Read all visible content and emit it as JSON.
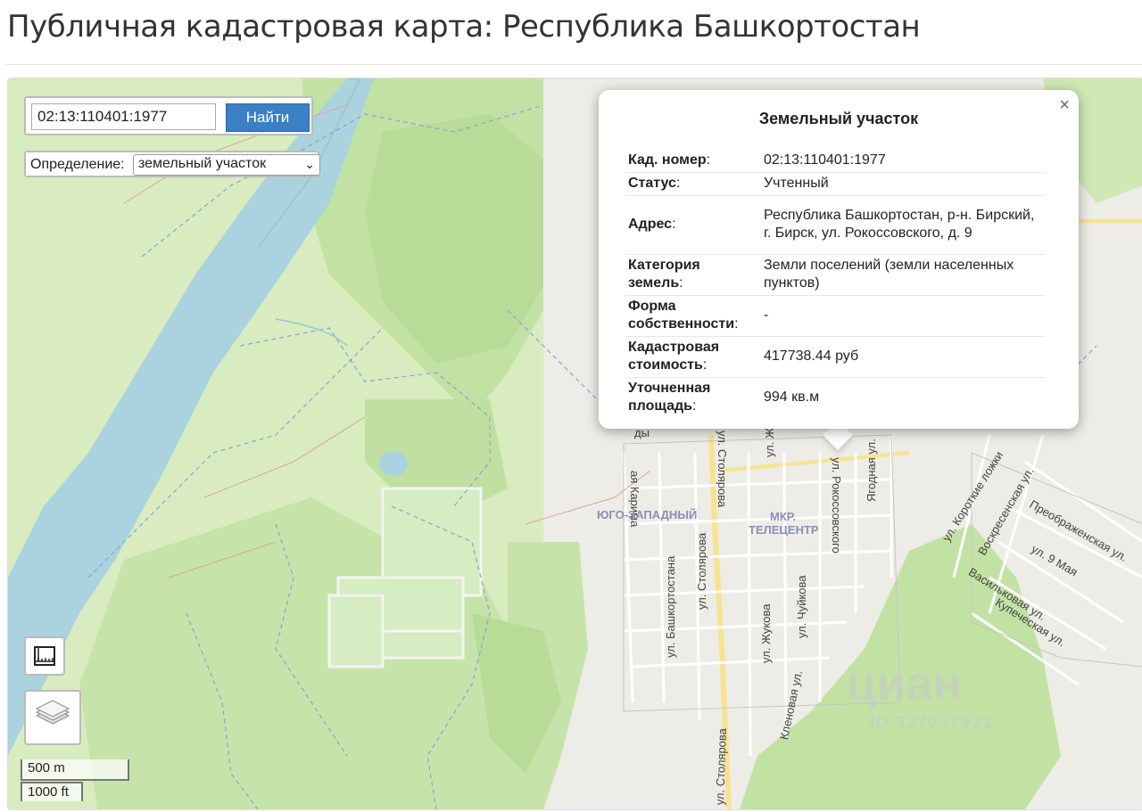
{
  "page_title": "Публичная кадастровая карта: Республика Башкортостан",
  "search": {
    "value": "02:13:110401:1977",
    "button_label": "Найти"
  },
  "definition": {
    "label": "Определение:",
    "selected": "земельный участок"
  },
  "popup": {
    "title": "Земельный участок",
    "close_symbol": "×",
    "rows": [
      {
        "key": "Кад. номер",
        "value": "02:13:110401:1977"
      },
      {
        "key": "Статус",
        "value": "Учтенный"
      },
      {
        "key": "Адрес",
        "value": "Республика Башкортостан, р-н. Бирский, г. Бирск, ул. Рокоссовского, д. 9"
      },
      {
        "key": "Категория земель",
        "value": "Земли поселений (земли населенных пунктов)"
      },
      {
        "key": "Форма собственности",
        "value": "-"
      },
      {
        "key": "Кадастровая стоимость",
        "value": "417738.44 руб"
      },
      {
        "key": "Уточненная площадь",
        "value": "994 кв.м"
      }
    ]
  },
  "scale": {
    "metric": "500 m",
    "imperial": "1000 ft"
  },
  "map_labels": {
    "districts": {
      "southwest": "ЮГО-ЗАПАДНЫЙ",
      "telecenter_line1": "МКР.",
      "telecenter_line2": "ТЕЛЕЦЕНТР"
    },
    "streets": {
      "karima": "ая Карима",
      "stolyarova_north": "ул. Столярова",
      "stolyarova_mid": "ул. Столярова",
      "stolyarova_south": "ул. Столярова",
      "bashkortostana": "ул. Башкортостана",
      "rokossovskogo": "ул. Рокоссовского",
      "yagodnaya": "Ягодная ул.",
      "chuykova": "ул. Чуйкова",
      "zhukova": "ул. Жукова",
      "klenovaya": "Кленовая ул.",
      "korotkie_lozhki": "ул. Короткие ложки",
      "voskresenskaya": "Воскресенская ул.",
      "preobrazhenskaya": "Преображенская ул.",
      "may9": "ул. 9 Мая",
      "vasilkovaya": "Васильковая ул.",
      "kupecheskaya": "Купеческая ул.",
      "fragment_dy": "ды",
      "fragment_zh": "ул. Ж"
    },
    "watermark": "циан",
    "watermark_id": "ID 327037931"
  },
  "colors": {
    "water": "#aad3df",
    "forest": "#add19e",
    "meadow": "#cdebb0",
    "land": "#f2efe9",
    "button": "#3b7fc4"
  },
  "icons": {
    "ruler": "ruler-icon",
    "layers": "layers-icon",
    "close": "close-icon",
    "chevron": "chevron-down-icon"
  }
}
